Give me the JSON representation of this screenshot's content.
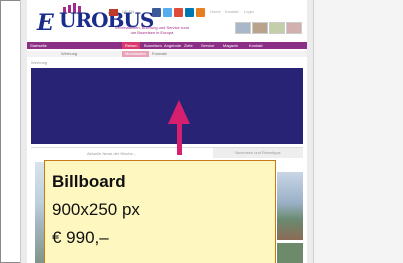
{
  "header": {
    "logo_initial": "E",
    "logo_text": "UROBUS",
    "flag_text": "DE EN",
    "links": [
      "Home",
      "Kontakt",
      "Login"
    ],
    "tagline": "Informationen, Buchung und Service rund um Busreisen in Europa"
  },
  "nav": {
    "items": [
      "Startseite",
      "Reisen",
      "Busreisen",
      "Angebote",
      "Ziele",
      "Service",
      "Magazin",
      "Kontakt"
    ],
    "active_index": 1
  },
  "subnav": {
    "items": [
      "Werbung",
      "Mediadaten",
      "Formate"
    ],
    "active_index": 1
  },
  "breadcrumb": "Werbung",
  "section": {
    "news_heading": "Aktuelle News der Woche...",
    "side_heading": "Busreisen und Reisetipps"
  },
  "callout": {
    "title": "Billboard",
    "size": "900x250 px",
    "price": "€ 990,–"
  },
  "colors": {
    "banner": "#292375",
    "arrow": "#d61f6e",
    "nav": "#8c2f86",
    "callout_bg": "#fff7c0",
    "callout_border": "#c87a1a"
  }
}
